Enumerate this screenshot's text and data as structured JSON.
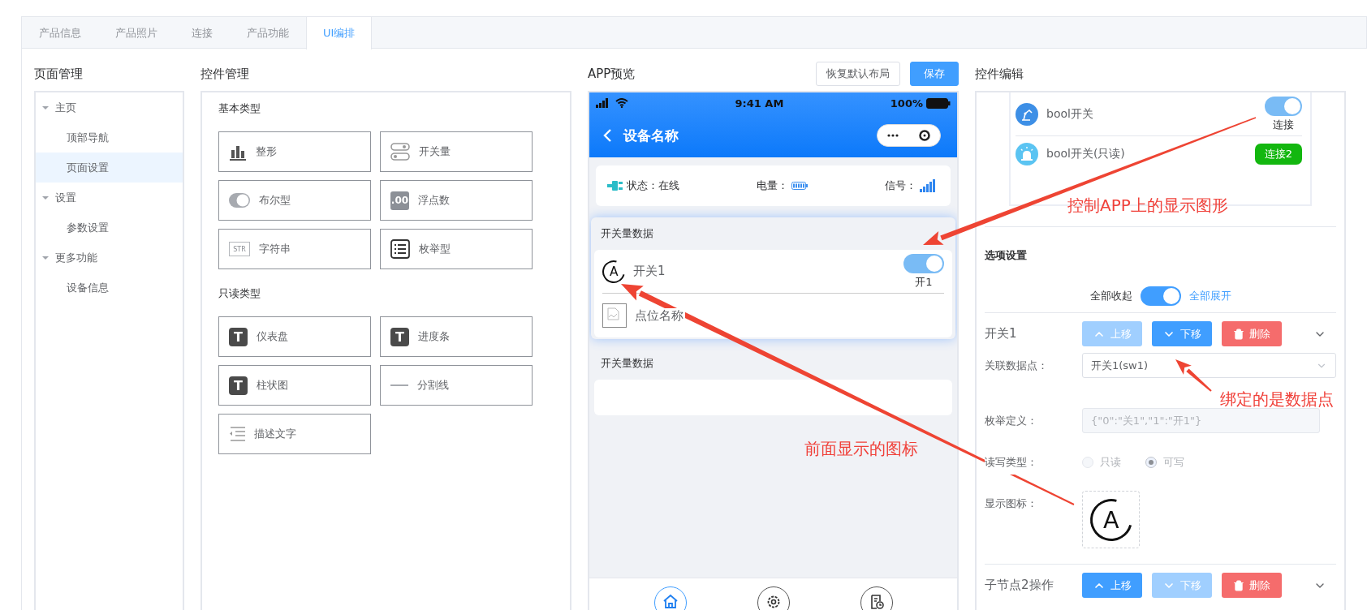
{
  "tabs": [
    {
      "label": "产品信息",
      "selected": false
    },
    {
      "label": "产品照片",
      "selected": false
    },
    {
      "label": "连接",
      "selected": false
    },
    {
      "label": "产品功能",
      "selected": false
    },
    {
      "label": "UI编排",
      "selected": true
    }
  ],
  "page_manager": {
    "title": "页面管理",
    "tree": [
      {
        "label": "主页",
        "expanded": true,
        "selected": false,
        "children": [
          {
            "label": "顶部导航",
            "selected": false
          },
          {
            "label": "页面设置",
            "selected": true
          }
        ]
      },
      {
        "label": "设置",
        "expanded": true,
        "selected": false,
        "children": [
          {
            "label": "参数设置",
            "selected": false
          }
        ]
      },
      {
        "label": "更多功能",
        "expanded": true,
        "selected": false,
        "children": [
          {
            "label": "设备信息",
            "selected": false
          }
        ]
      }
    ]
  },
  "widget_manager": {
    "title": "控件管理",
    "groups": [
      {
        "title": "基本类型",
        "items": [
          {
            "kind": "chart",
            "label": "整形"
          },
          {
            "kind": "switch",
            "label": "开关量"
          },
          {
            "kind": "toggle",
            "label": "布尔型"
          },
          {
            "kind": "badge",
            "icon_text": ".00",
            "label": "浮点数"
          },
          {
            "kind": "tag",
            "icon_text": "STR",
            "label": "字符串"
          },
          {
            "kind": "list",
            "label": "枚举型"
          }
        ]
      },
      {
        "title": "只读类型",
        "items": [
          {
            "kind": "letter",
            "icon_text": "T",
            "label": "仪表盘"
          },
          {
            "kind": "letter",
            "icon_text": "T",
            "label": "进度条"
          },
          {
            "kind": "letter",
            "icon_text": "T",
            "label": "柱状图"
          },
          {
            "kind": "divider",
            "label": "分割线"
          },
          {
            "kind": "indent",
            "label": "描述文字"
          }
        ]
      }
    ]
  },
  "app_preview": {
    "title": "APP预览",
    "buttons": [
      {
        "kind": "default",
        "label": "恢复默认布局"
      },
      {
        "kind": "primary",
        "label": "保存"
      }
    ],
    "phone": {
      "time": "9:41 AM",
      "battery": "100%",
      "nav_title": "设备名称",
      "info": {
        "status": "状态：在线",
        "power": "电量：",
        "signal": "信号："
      },
      "sections": [
        {
          "title": "开关量数据",
          "highlighted": true,
          "rows": [
            {
              "kind": "switch",
              "icon_text": "A",
              "label": "开关1",
              "on": true,
              "caption": "开1"
            },
            {
              "kind": "point",
              "label": "点位名称"
            }
          ]
        },
        {
          "title": "开关量数据",
          "highlighted": false
        }
      ],
      "tab_bar": [
        {
          "kind": "home",
          "selected": true
        },
        {
          "kind": "settings",
          "selected": false
        },
        {
          "kind": "report",
          "selected": false
        }
      ]
    }
  },
  "widget_editor": {
    "title": "控件编辑",
    "preview": [
      {
        "kind": "toggle",
        "label": "bool开关",
        "on": true,
        "caption": "连接"
      },
      {
        "kind": "tag",
        "label": "bool开关(只读)",
        "tag": "连接2"
      }
    ],
    "options": {
      "title": "选项设置",
      "collapse_label": "全部收起",
      "expand_label": "全部展开",
      "on": true,
      "nodes": [
        {
          "name": "开关1",
          "up": {
            "label": "上移",
            "disabled": true
          },
          "down": {
            "label": "下移",
            "disabled": false
          },
          "delete": "删除",
          "fields": [
            {
              "kind": "select",
              "label": "关联数据点：",
              "value": "开关1(sw1)"
            },
            {
              "kind": "input",
              "label": "枚举定义：",
              "value": "{\"0\":\"关1\",\"1\":\"开1\"}",
              "disabled": true
            },
            {
              "kind": "radio",
              "label": "读写类型：",
              "options": [
                {
                  "label": "只读",
                  "selected": false
                },
                {
                  "label": "可写",
                  "selected": true
                }
              ]
            },
            {
              "kind": "icon",
              "label": "显示图标：",
              "icon_text": "A"
            }
          ]
        },
        {
          "name": "子节点2操作",
          "up": {
            "label": "上移",
            "disabled": false
          },
          "down": {
            "label": "下移",
            "disabled": true
          },
          "delete": "删除"
        }
      ]
    }
  },
  "annotations": [
    {
      "text": "控制APP上的显示图形"
    },
    {
      "text": "绑定的是数据点"
    },
    {
      "text": "前面显示的图标"
    }
  ]
}
